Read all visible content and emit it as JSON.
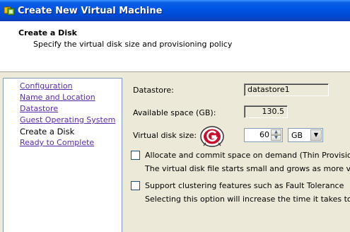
{
  "window": {
    "title": "Create New Virtual Machine"
  },
  "header": {
    "title": "Create a Disk",
    "subtitle": "Specify the virtual disk size and provisioning policy"
  },
  "nav": {
    "items": [
      {
        "label": "Configuration",
        "current": false
      },
      {
        "label": "Name and Location",
        "current": false
      },
      {
        "label": "Datastore",
        "current": false
      },
      {
        "label": "Guest Operating System",
        "current": false
      },
      {
        "label": "Create a Disk",
        "current": true
      },
      {
        "label": "Ready to Complete",
        "current": false
      }
    ]
  },
  "form": {
    "datastore_label": "Datastore:",
    "datastore_value": "datastore1",
    "available_label": "Available space (GB):",
    "available_value": "130.5",
    "disk_size_label": "Virtual disk size:",
    "disk_size_value": "60",
    "disk_size_unit": "GB",
    "thin_provisioning_label": "Allocate and commit space on demand (Thin Provisioning)",
    "thin_provisioning_desc": "The virtual disk file starts small and grows as more virtual disk",
    "thin_provisioning_checked": false,
    "clustering_label": "Support clustering features such as Fault Tolerance",
    "clustering_desc": "Selecting this option will increase the time it takes to create th",
    "clustering_checked": false
  },
  "colors": {
    "titlebar": "#0055e5",
    "link": "#5a2ab0",
    "logo_red": "#c8102e"
  },
  "icons": {
    "title": "vm-wizard-icon",
    "logo": "g-logo-icon"
  }
}
